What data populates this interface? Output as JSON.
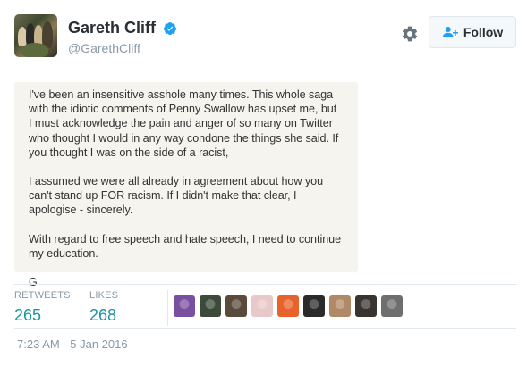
{
  "user": {
    "display_name": "Gareth Cliff",
    "handle": "@GarethCliff",
    "verified": true,
    "verified_icon": "verified-badge-icon"
  },
  "actions": {
    "settings_icon": "gear-icon",
    "follow_label": "Follow",
    "follow_icon": "add-person-icon"
  },
  "tweet": {
    "paragraphs": [
      "I've been an insensitive asshole many times. This whole saga with the idiotic comments of Penny Swallow has upset me, but I must acknowledge the pain and anger of so many on Twitter who thought I would in any way condone the things she said. If you thought I was on the side of a racist,",
      "I assumed we were all already in agreement about how you can't stand up FOR racism. If I didn't make that clear, I apologise - sincerely.",
      "With regard to free speech and hate speech, I need to continue my education.",
      "G"
    ]
  },
  "stats": {
    "retweets_label": "RETWEETS",
    "retweets_count": "265",
    "likes_label": "LIKES",
    "likes_count": "268"
  },
  "likers": {
    "count_shown": 9,
    "colors": [
      "#7a4fa0",
      "#3c4a3a",
      "#5a4a3a",
      "#e8c8c8",
      "#e8622c",
      "#2a2a2a",
      "#b08a66",
      "#3a3430",
      "#6e6e6e"
    ]
  },
  "timestamp": "7:23 AM - 5 Jan 2016",
  "colors": {
    "accent": "#1b95a0",
    "verified": "#1da1f2",
    "muted": "#8899a6"
  }
}
